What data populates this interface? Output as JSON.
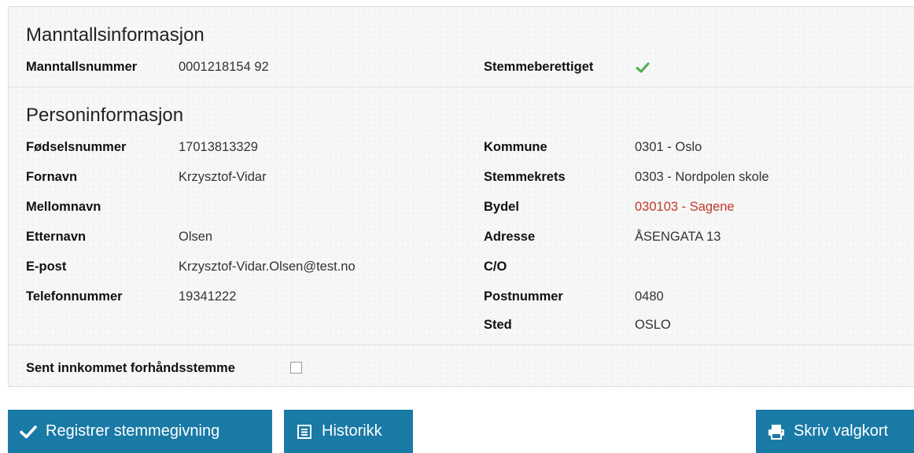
{
  "manntall": {
    "heading": "Manntallsinformasjon",
    "number_label": "Manntallsnummer",
    "number_value": "0001218154 92",
    "eligible_label": "Stemmeberettiget",
    "eligible_icon": "check-icon",
    "eligible_color": "#4caf50"
  },
  "person": {
    "heading": "Personinformasjon",
    "left": [
      {
        "label": "Fødselsnummer",
        "value": "17013813329"
      },
      {
        "label": "Fornavn",
        "value": "Krzysztof-Vidar"
      },
      {
        "label": "Mellomnavn",
        "value": ""
      },
      {
        "label": "Etternavn",
        "value": "Olsen"
      },
      {
        "label": "E-post",
        "value": "Krzysztof-Vidar.Olsen@test.no"
      },
      {
        "label": "Telefonnummer",
        "value": "19341222"
      }
    ],
    "right": [
      {
        "label": "Kommune",
        "value": "0301 - Oslo"
      },
      {
        "label": "Stemmekrets",
        "value": "0303 - Nordpolen skole"
      },
      {
        "label": "Bydel",
        "value": "030103 - Sagene"
      },
      {
        "label": "Adresse",
        "value": "ÅSENGATA 13"
      },
      {
        "label": "C/O",
        "value": ""
      },
      {
        "label": "Postnummer",
        "value": "0480"
      },
      {
        "label": "Sted",
        "value": "OSLO"
      }
    ]
  },
  "late_vote": {
    "label": "Sent innkommet forhåndsstemme",
    "checked": false
  },
  "actions": {
    "register_label": "Registrer stemmegivning",
    "history_label": "Historikk",
    "print_label": "Skriv valgkort"
  },
  "colors": {
    "button": "#1a7aa6",
    "bydel_text": "#c0392b"
  }
}
